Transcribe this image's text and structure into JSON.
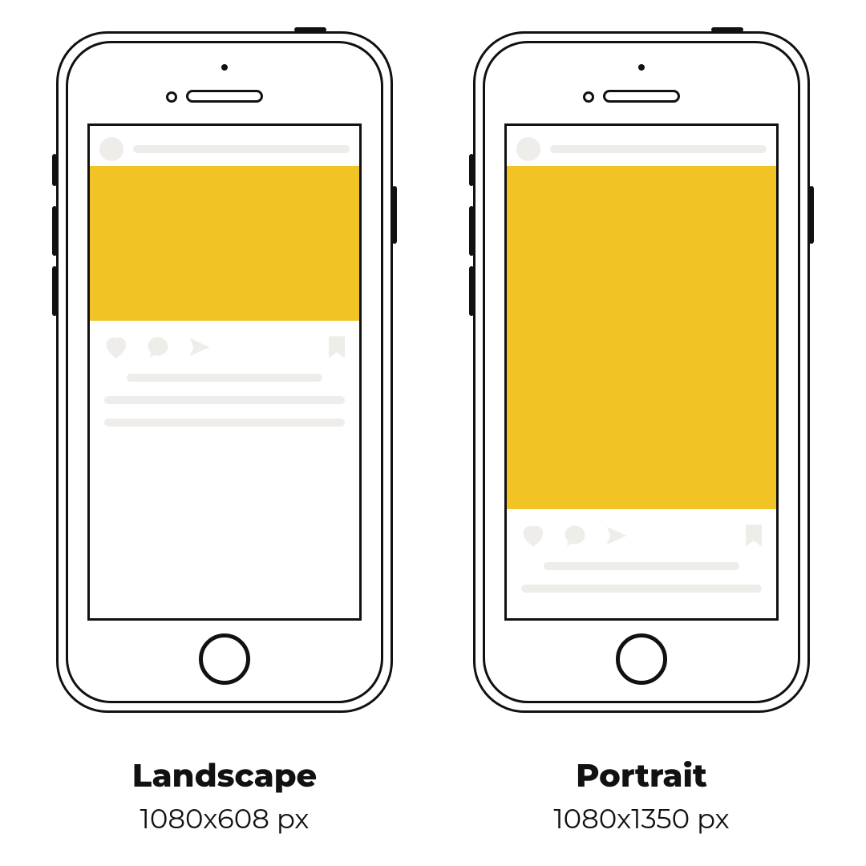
{
  "colors": {
    "accent": "#f2c324",
    "placeholder": "#eeede9",
    "stroke": "#111111"
  },
  "mockups": {
    "landscape": {
      "label": "Landscape",
      "dimensions": "1080x608 px"
    },
    "portrait": {
      "label": "Portrait",
      "dimensions": "1080x1350 px"
    }
  },
  "icons": {
    "heart": "heart-icon",
    "comment": "comment-icon",
    "send": "send-icon",
    "bookmark": "bookmark-icon"
  }
}
